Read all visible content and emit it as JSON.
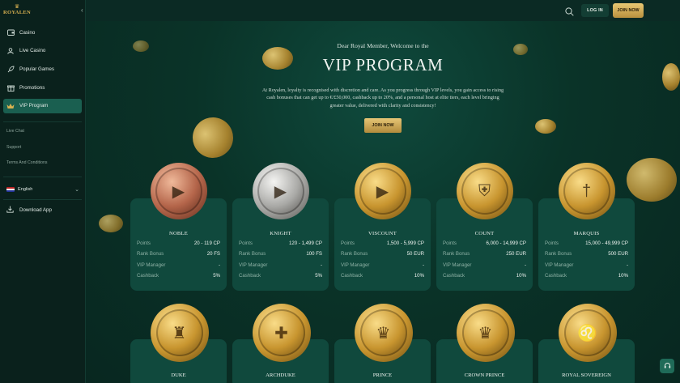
{
  "brand": {
    "name": "ROYALEN"
  },
  "sidebar": {
    "items": [
      {
        "label": "Casino",
        "icon": "wallet-icon"
      },
      {
        "label": "Live Casino",
        "icon": "user-icon"
      },
      {
        "label": "Popular Games",
        "icon": "rocket-icon"
      },
      {
        "label": "Promotions",
        "icon": "gift-icon"
      },
      {
        "label": "VIP Program",
        "icon": "crown-icon",
        "active": true
      }
    ],
    "links": [
      "Live Chat",
      "Support",
      "Terms And Conditions"
    ],
    "language": "English",
    "download": "Download App"
  },
  "header": {
    "login": "LOG IN",
    "join": "JOIN NOW"
  },
  "hero": {
    "greeting": "Dear Royal Member, Welcome to the",
    "title": "VIP PROGRAM",
    "description": "At Royalen, loyalty is recognised with discretion and care. As you progress through VIP levels, you gain access to rising cash bonuses that can get up to €/£50,000, cashback up to 20%, and a personal host at elite tiers, each level bringing greater value, delivered with clarity and consistency!",
    "cta": "JOIN NOW"
  },
  "labels": {
    "points": "Points",
    "rank_bonus": "Rank Bonus",
    "vip_manager": "VIP Manager",
    "cashback": "Cashback"
  },
  "tiers": [
    {
      "name": "NOBLE",
      "points": "20 - 119 CP",
      "rank_bonus": "20 FS",
      "vip_manager": "-",
      "cashback": "5%",
      "metal": "bronze",
      "emblem": "play"
    },
    {
      "name": "KNIGHT",
      "points": "120 - 1,499 CP",
      "rank_bonus": "100 FS",
      "vip_manager": "-",
      "cashback": "5%",
      "metal": "silver",
      "emblem": "play"
    },
    {
      "name": "VISCOUNT",
      "points": "1,500 - 5,999 CP",
      "rank_bonus": "50 EUR",
      "vip_manager": "-",
      "cashback": "10%",
      "metal": "gold",
      "emblem": "play"
    },
    {
      "name": "COUNT",
      "points": "6,000 - 14,999 CP",
      "rank_bonus": "250 EUR",
      "vip_manager": "-",
      "cashback": "10%",
      "metal": "gold",
      "emblem": "shield"
    },
    {
      "name": "MARQUIS",
      "points": "15,000 - 49,999 CP",
      "rank_bonus": "500 EUR",
      "vip_manager": "-",
      "cashback": "10%",
      "metal": "gold",
      "emblem": "sword"
    }
  ],
  "tiers_row2": [
    {
      "name": "DUKE",
      "emblem": "helmet"
    },
    {
      "name": "ARCHDUKE",
      "emblem": "cross"
    },
    {
      "name": "PRINCE",
      "emblem": "crown"
    },
    {
      "name": "CROWN PRINCE",
      "emblem": "gem-crown"
    },
    {
      "name": "ROYAL SOVEREIGN",
      "emblem": "lion"
    }
  ]
}
